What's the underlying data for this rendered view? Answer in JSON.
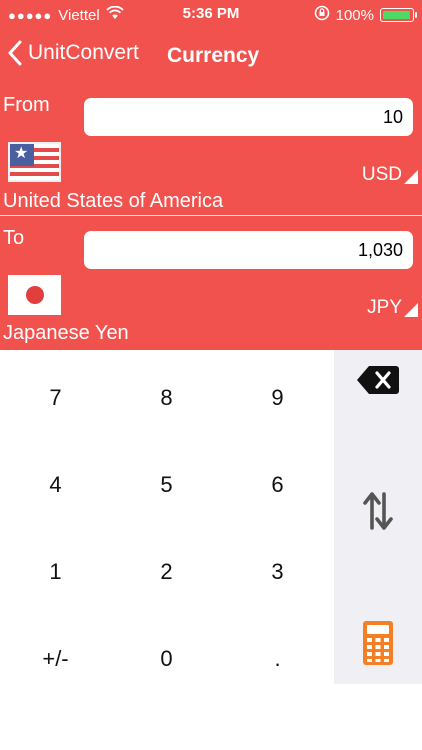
{
  "status_bar": {
    "signal_dots": "●●●●●",
    "carrier": "Viettel",
    "time": "5:36 PM",
    "battery_percent": "100%",
    "battery_level": 1.0,
    "battery_color": "#4cd964",
    "icons": [
      "wifi-icon",
      "rotation-lock-icon",
      "battery-icon"
    ]
  },
  "nav": {
    "back_label": "UnitConvert",
    "title": "Currency"
  },
  "from": {
    "label": "From",
    "value": "10",
    "flag": "us-flag-icon",
    "currency_code": "USD",
    "country": "United States of America"
  },
  "to": {
    "label": "To",
    "value": "1,030",
    "flag": "japan-flag-icon",
    "currency_code": "JPY",
    "country": "Japanese Yen"
  },
  "keypad": {
    "keys": [
      "7",
      "8",
      "9",
      "4",
      "5",
      "6",
      "1",
      "2",
      "3",
      "+/-",
      "0",
      "."
    ],
    "side_buttons": [
      "backspace-icon",
      "swap-icon",
      "calculator-icon"
    ]
  },
  "colors": {
    "accent": "#f2524e",
    "keypad_side": "#efeff4",
    "calculator_icon": "#f47f25"
  }
}
